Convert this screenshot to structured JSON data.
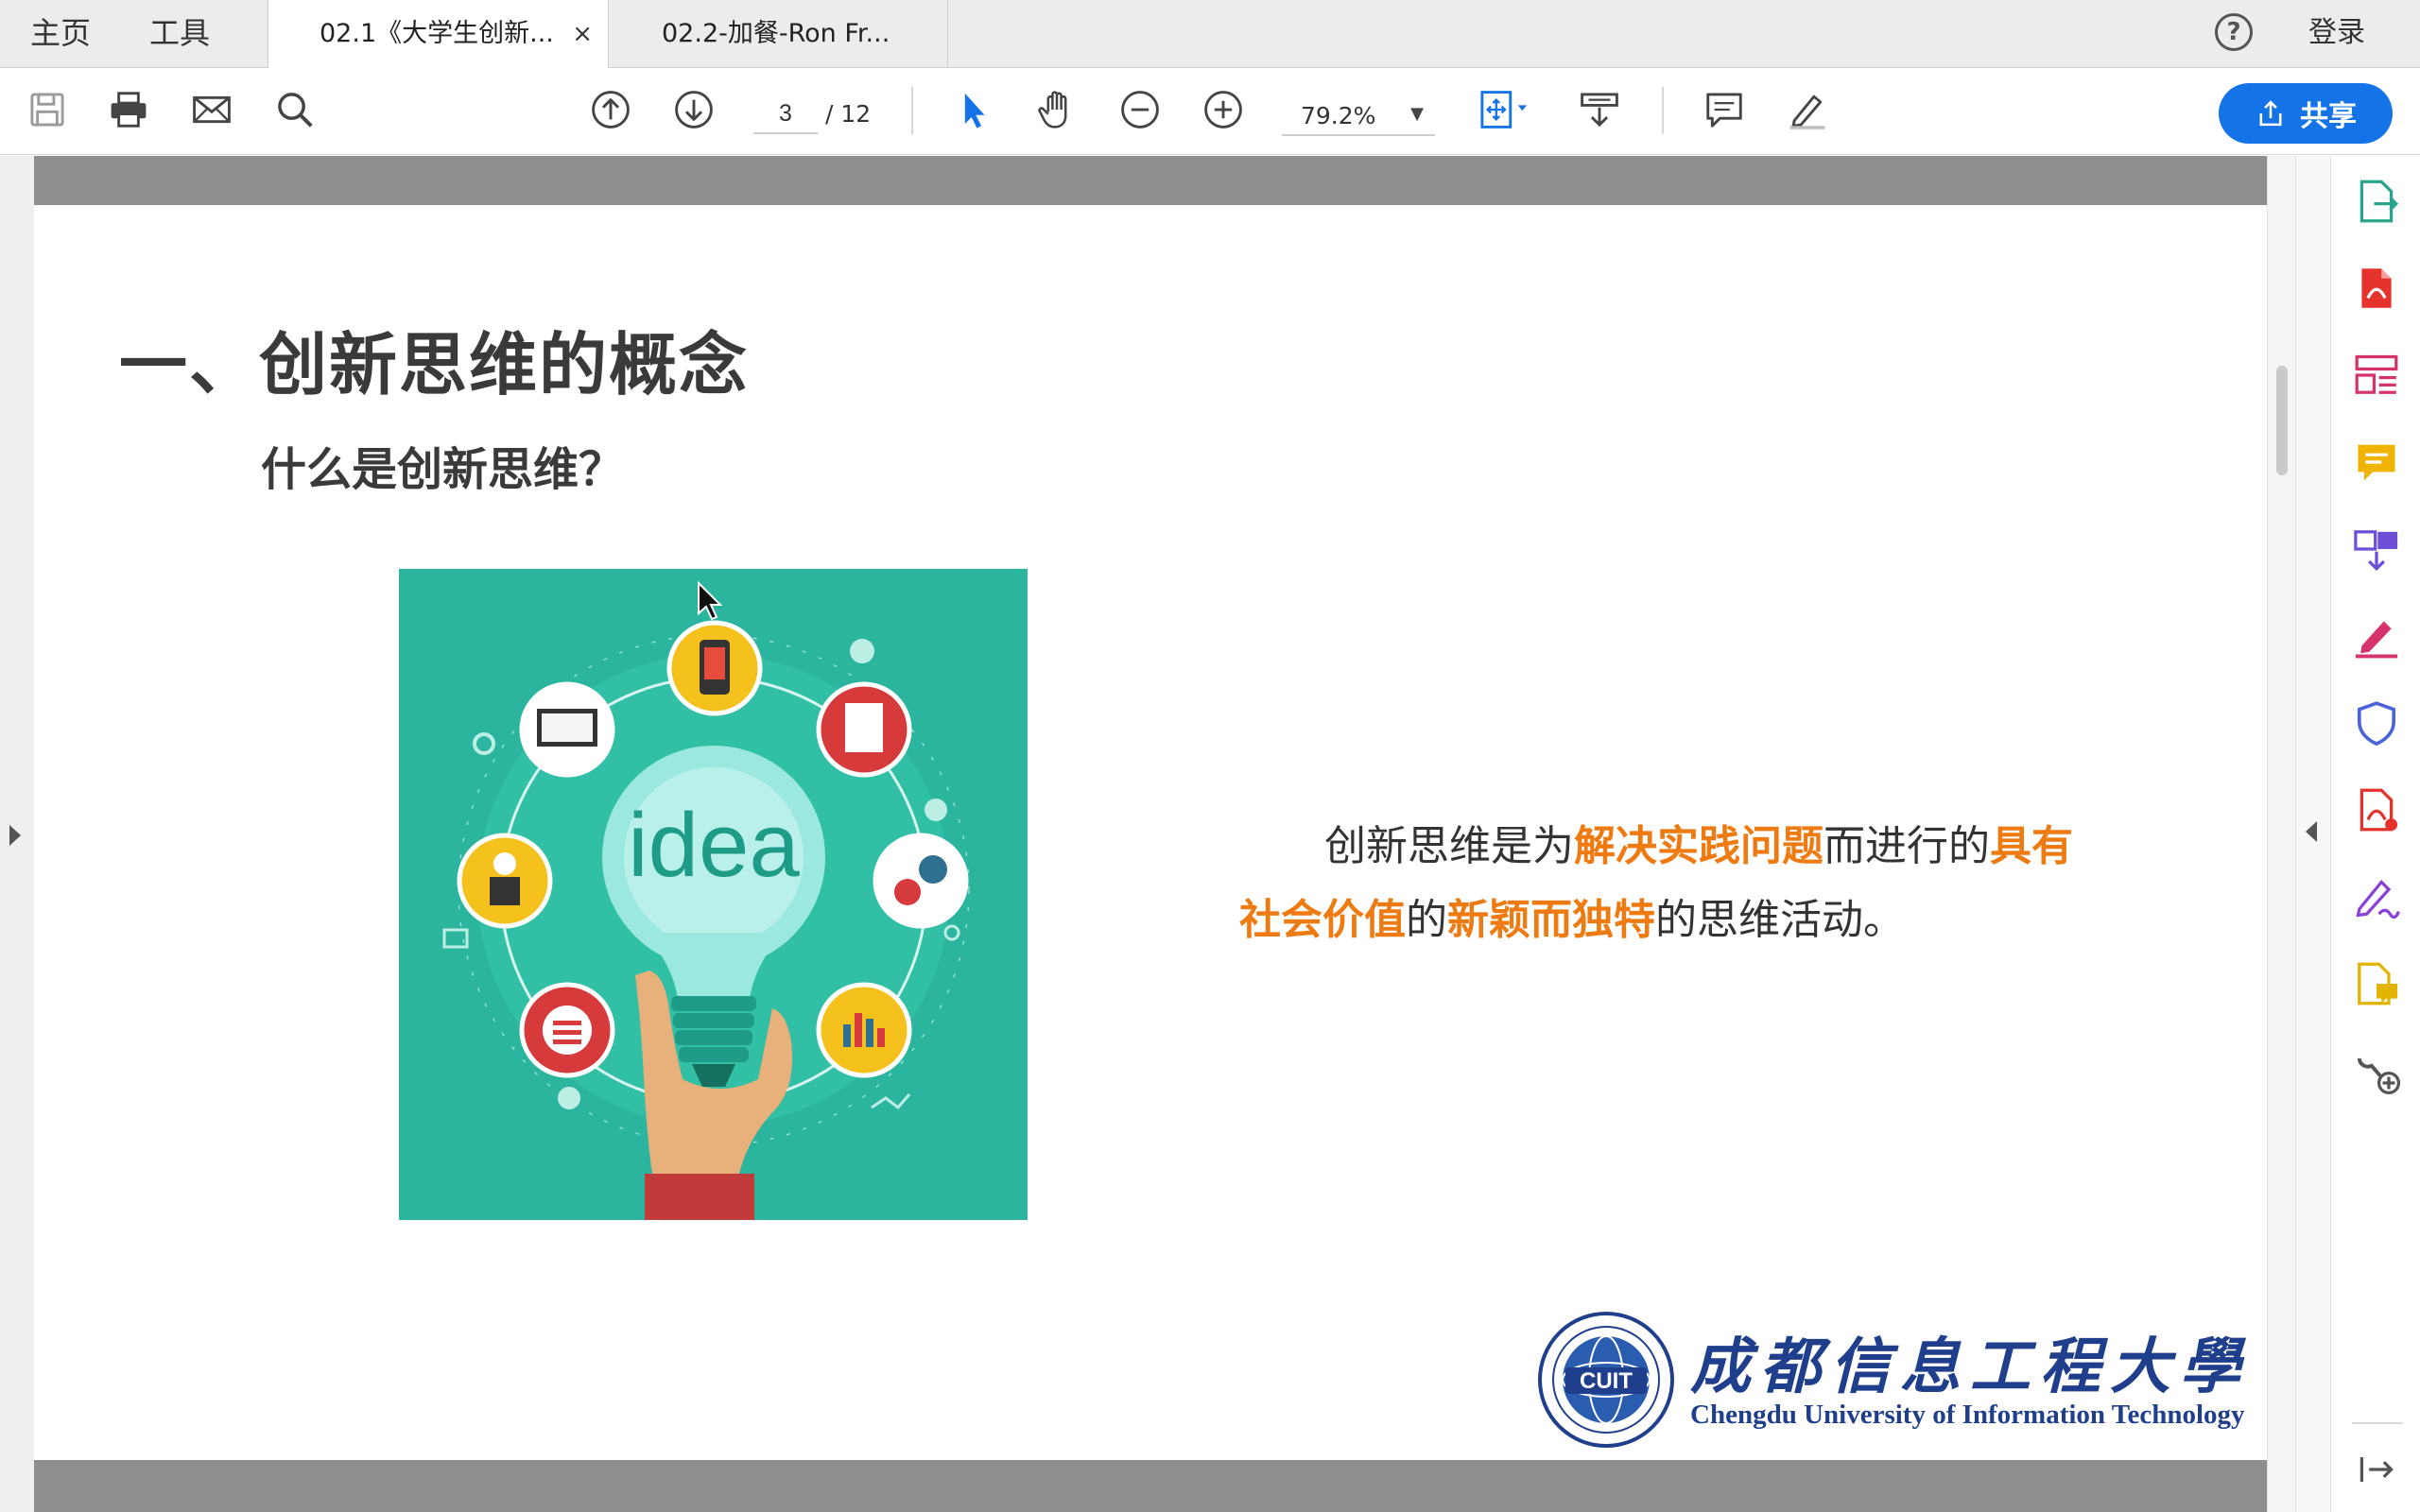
{
  "tabbar": {
    "home_label": "主页",
    "tools_label": "工具",
    "tabs": [
      {
        "label": "02.1《大学生创新..."
      },
      {
        "label": "02.2-加餐-Ron Fr..."
      }
    ],
    "close_glyph": "×",
    "help_glyph": "?",
    "login_label": "登录"
  },
  "toolbar": {
    "page_current": "3",
    "page_total": "/ 12",
    "zoom": "79.2%",
    "zoom_caret": "▼",
    "share_label": "共享",
    "icons": [
      "save-icon",
      "print-icon",
      "email-icon",
      "search-icon",
      "prev-page-icon",
      "next-page-icon",
      "select-cursor-icon",
      "hand-tool-icon",
      "zoom-out-icon",
      "zoom-in-icon",
      "fit-page-icon",
      "read-mode-icon",
      "comment-icon",
      "highlight-pen-icon",
      "share-icon"
    ]
  },
  "slide": {
    "title": "一、创新思维的概念",
    "subtitle": "什么是创新思维？",
    "illustration_text": "idea",
    "definition_parts": [
      {
        "text": "创新思维是为",
        "highlight": false
      },
      {
        "text": "解决实践问题",
        "highlight": true
      },
      {
        "text": "而进行的",
        "highlight": false
      },
      {
        "text": "具有社会价值",
        "highlight": true
      },
      {
        "text": "的",
        "highlight": false
      },
      {
        "text": "新颖而独特",
        "highlight": true
      },
      {
        "text": "的思维活动。",
        "highlight": false
      }
    ],
    "logo": {
      "seal_text": "CUIT",
      "name_cn": "成都信息工程大學",
      "name_en": "Chengdu University of Information Technology"
    }
  },
  "right_panel": {
    "tools": [
      "export-pdf-icon",
      "create-pdf-icon",
      "organize-pages-icon",
      "comment-tool-icon",
      "combine-files-icon",
      "fill-sign-icon",
      "protect-icon",
      "edit-pdf-icon",
      "request-signature-icon",
      "send-for-comments-icon",
      "more-tools-icon"
    ]
  },
  "colors": {
    "accent_blue": "#1473e6",
    "highlight_orange": "#ee7a12",
    "illustration_teal": "#2bb59e",
    "logo_blue": "#1f3e8c"
  }
}
